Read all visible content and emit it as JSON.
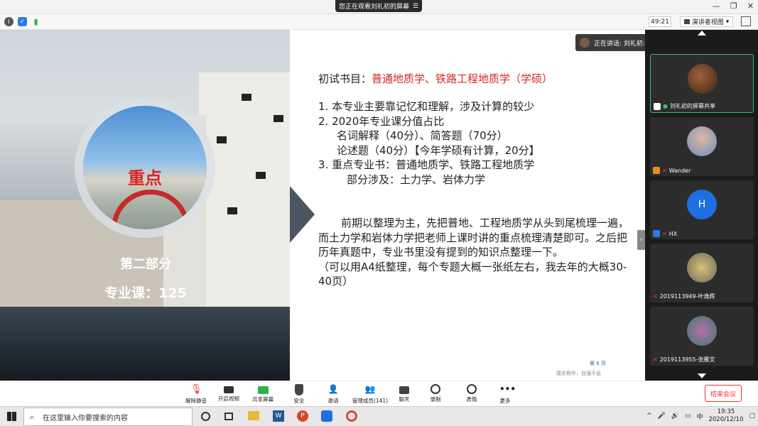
{
  "titlebar": {
    "share_banner": "您正在观看刘礼初的屏幕"
  },
  "toolbar": {
    "timer": "49:21",
    "view_label": "演讲者视图"
  },
  "slide_left": {
    "keypoint": "重点",
    "part_label": "第二部分",
    "course_label": "专业课：125"
  },
  "slide": {
    "title_prefix": "初试书目：",
    "title_books": "普通地质学、铁路工程地质学（学硕）",
    "lines": [
      "1.  本专业主要靠记忆和理解，涉及计算的较少",
      "2.  2020年专业课分值占比",
      "名词解释（40分）、简答题（70分）",
      "论述题（40分）【今年学硕有计算，20分】",
      "3.  重点专业书：普通地质学、铁路工程地质学",
      "部分涉及：土力学、岩体力学"
    ],
    "para1": "前期以整理为主，先把普地、工程地质学从头到尾梳理一遍，而土力学和岩体力学把老师上课时讲的重点梳理清楚即可。之后把历年真题中，专业书里没有提到的知识点整理一下。",
    "para2": "（可以用A4纸整理，每个专题大概一张纸左右，我去年的大概30-40页）",
    "page_num": "第 6 页",
    "motto": "箴实杨华，自强不息"
  },
  "speaking": {
    "label": "正在讲话: 刘礼初:"
  },
  "participants": [
    {
      "label": "刘礼初的屏幕共享"
    },
    {
      "label": "Wander"
    },
    {
      "label": "HX",
      "initial": "H"
    },
    {
      "label": "2019113949-叶逸辉"
    },
    {
      "label": "2019113955-张雁文"
    }
  ],
  "controls": {
    "mute": "解除静音",
    "video": "开启视频",
    "share": "共享屏幕",
    "security": "安全",
    "invite": "邀请",
    "members": "管理成员(141)",
    "chat": "聊天",
    "record": "录制",
    "reaction": "表情",
    "more": "更多",
    "end": "结束会议"
  },
  "taskbar": {
    "search_placeholder": "在这里输入你要搜索的内容",
    "time": "19:35",
    "date": "2020/12/10",
    "ime": "中"
  },
  "colors": {
    "accent_red": "#d62727",
    "active_green": "#36c36b"
  }
}
